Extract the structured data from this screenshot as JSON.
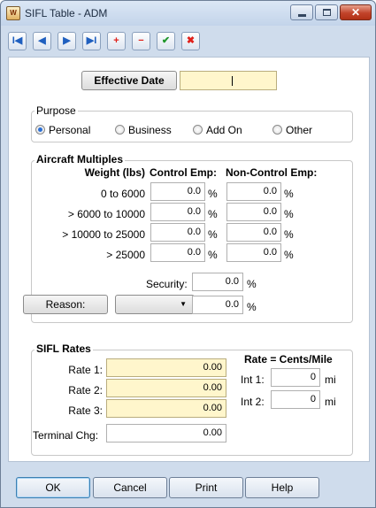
{
  "window": {
    "title": "SIFL Table - ADM",
    "app_icon_text": "W"
  },
  "title_controls": {
    "minimize": "minimize",
    "maximize": "maximize",
    "close": "✕"
  },
  "toolbar": {
    "first": "I◀",
    "prev": "◀",
    "next": "▶",
    "last": "▶I",
    "add": "+",
    "remove": "−",
    "accept": "✔",
    "cancel": "✖"
  },
  "effective_date": {
    "button_label": "Effective Date",
    "value": ""
  },
  "purpose": {
    "title": "Purpose",
    "options": [
      "Personal",
      "Business",
      "Add On",
      "Other"
    ],
    "selected": "Personal"
  },
  "aircraft_multiples": {
    "title": "Aircraft Multiples",
    "columns": {
      "weight": "Weight (lbs)",
      "control": "Control Emp:",
      "non_control": "Non-Control Emp:"
    },
    "rows": [
      {
        "weight": "0 to 6000",
        "control": "0.0",
        "non_control": "0.0"
      },
      {
        "weight": "> 6000 to 10000",
        "control": "0.0",
        "non_control": "0.0"
      },
      {
        "weight": "> 10000 to 25000",
        "control": "0.0",
        "non_control": "0.0"
      },
      {
        "weight": "> 25000",
        "control": "0.0",
        "non_control": "0.0"
      }
    ],
    "percent_sign": "%",
    "security_label": "Security:",
    "security_value": "0.0",
    "reason_button": "Reason:",
    "reason_select": "",
    "reason_value": "0.0"
  },
  "sifl_rates": {
    "title": "SIFL Rates",
    "rates": [
      {
        "label": "Rate 1:",
        "value": "0.00"
      },
      {
        "label": "Rate 2:",
        "value": "0.00"
      },
      {
        "label": "Rate 3:",
        "value": "0.00"
      }
    ],
    "terminal_label": "Terminal Chg:",
    "terminal_value": "0.00",
    "rate_header": "Rate = Cents/Mile",
    "ints": [
      {
        "label": "Int 1:",
        "value": "0",
        "unit": "mi"
      },
      {
        "label": "Int 2:",
        "value": "0",
        "unit": "mi"
      }
    ]
  },
  "footer": {
    "ok": "OK",
    "cancel": "Cancel",
    "print": "Print",
    "help": "Help"
  },
  "colors": {
    "required_field": "#fff6cc",
    "radio_selected": "#2a6fd6",
    "close_button": "#c2432a"
  }
}
